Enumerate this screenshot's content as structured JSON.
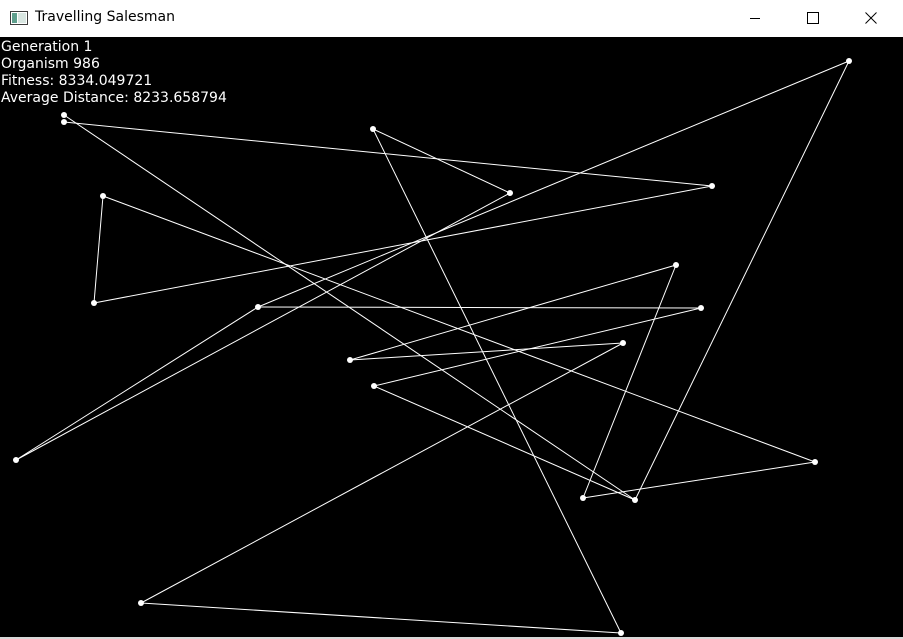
{
  "window": {
    "title": "Travelling Salesman",
    "icon": "app-window-icon",
    "controls": {
      "minimize": "minimize-icon",
      "maximize": "maximize-icon",
      "close": "close-icon"
    }
  },
  "stats": {
    "generation": "Generation 1",
    "organism": "Organism 986",
    "fitness": "Fitness: 8334.049721",
    "average_distance": "Average Distance: 8233.658794"
  },
  "colors": {
    "canvas_background": "#000000",
    "route_line": "#ffffff",
    "city_dot": "#ffffff",
    "text": "#ffffff"
  }
}
